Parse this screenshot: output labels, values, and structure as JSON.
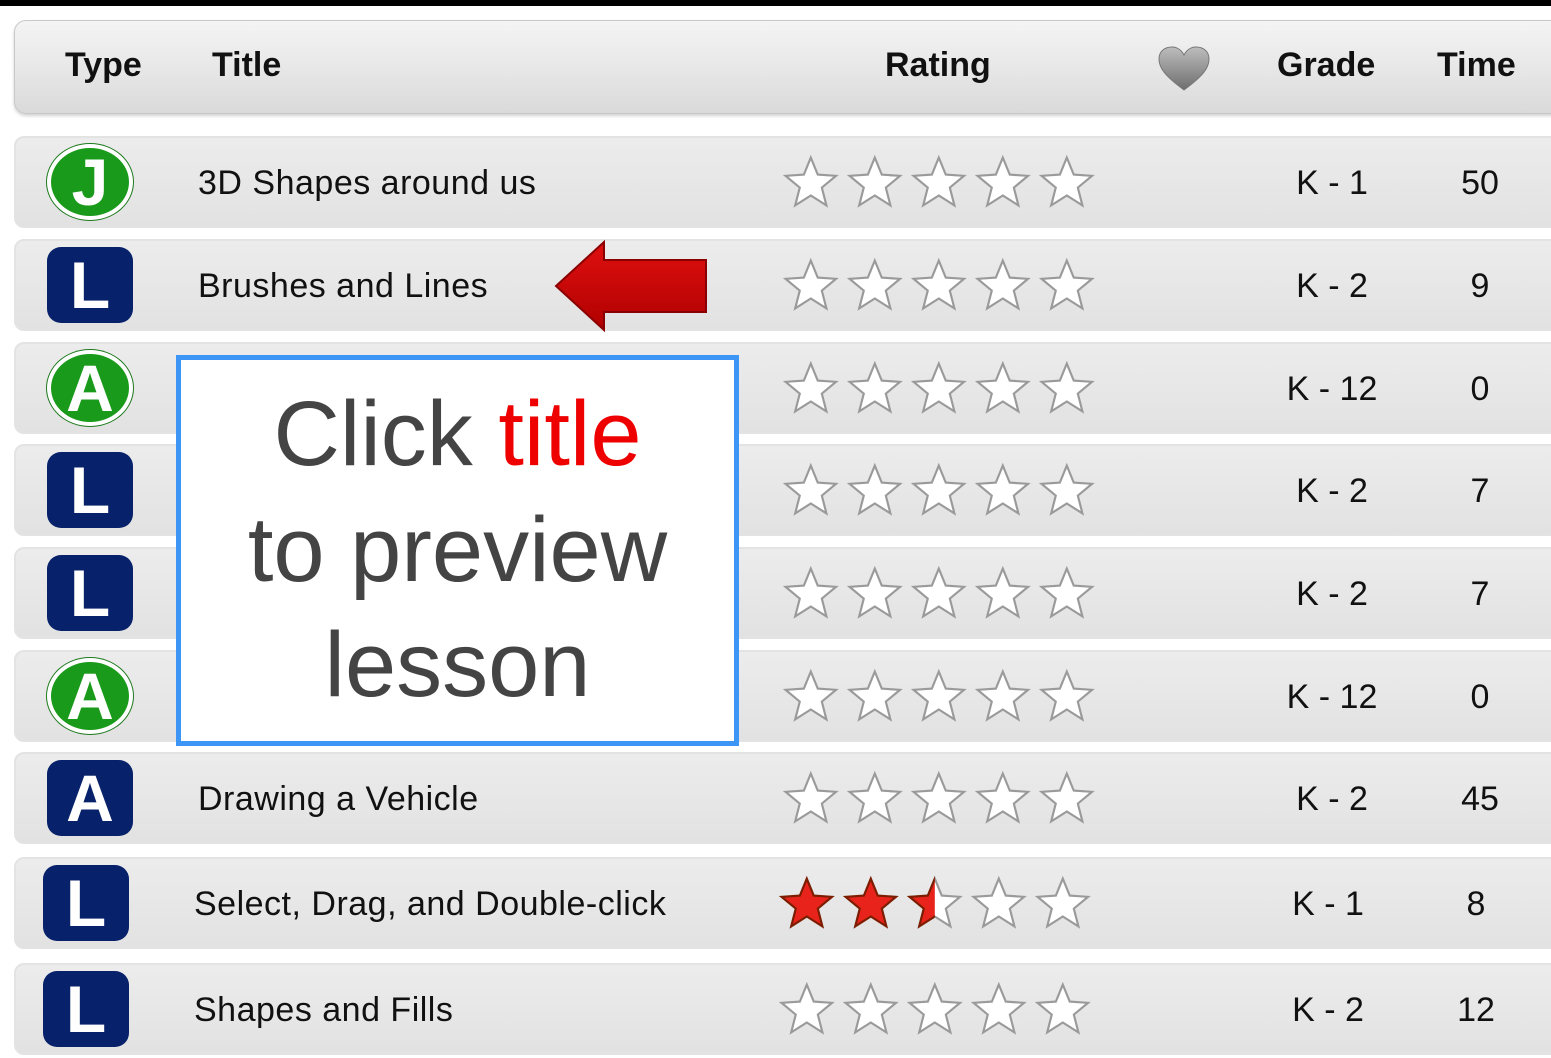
{
  "header": {
    "type": "Type",
    "title": "Title",
    "rating": "Rating",
    "favorite_icon": "heart-icon",
    "grade": "Grade",
    "time": "Time"
  },
  "rows": [
    {
      "badge_letter": "J",
      "badge_style": "green-circle",
      "title": "3D Shapes around us",
      "rating": 0,
      "grade": "K - 1",
      "time": "50"
    },
    {
      "badge_letter": "L",
      "badge_style": "navy-square",
      "title": "Brushes and Lines",
      "rating": 0,
      "grade": "K - 2",
      "time": "9"
    },
    {
      "badge_letter": "A",
      "badge_style": "green-circle",
      "title": "",
      "rating": 0,
      "grade": "K - 12",
      "time": "0"
    },
    {
      "badge_letter": "L",
      "badge_style": "navy-square",
      "title": "",
      "rating": 0,
      "grade": "K - 2",
      "time": "7"
    },
    {
      "badge_letter": "L",
      "badge_style": "navy-square",
      "title": "",
      "rating": 0,
      "grade": "K - 2",
      "time": "7"
    },
    {
      "badge_letter": "A",
      "badge_style": "green-circle",
      "title": "",
      "rating": 0,
      "grade": "K - 12",
      "time": "0"
    },
    {
      "badge_letter": "A",
      "badge_style": "navy-square",
      "title": "Drawing a Vehicle",
      "rating": 0,
      "grade": "K - 2",
      "time": "45"
    },
    {
      "badge_letter": "L",
      "badge_style": "navy-square",
      "title": "Select, Drag, and Double-click",
      "rating": 2.5,
      "grade": "K - 1",
      "time": "8"
    },
    {
      "badge_letter": "L",
      "badge_style": "navy-square",
      "title": "Shapes and Fills",
      "rating": 0,
      "grade": "K - 2",
      "time": "12"
    }
  ],
  "rating_max": 5,
  "callout": {
    "part1": "Click ",
    "highlight": "title",
    "line2": "to preview",
    "line3": "lesson"
  },
  "colors": {
    "badge_green": "#1a9a1a",
    "badge_navy": "#07226a",
    "arrow": "#cc0000",
    "callout_border": "#3d96f5",
    "callout_highlight": "#ee0000",
    "star_filled": "#e8231b"
  },
  "annotation_icon": "left-arrow-icon"
}
